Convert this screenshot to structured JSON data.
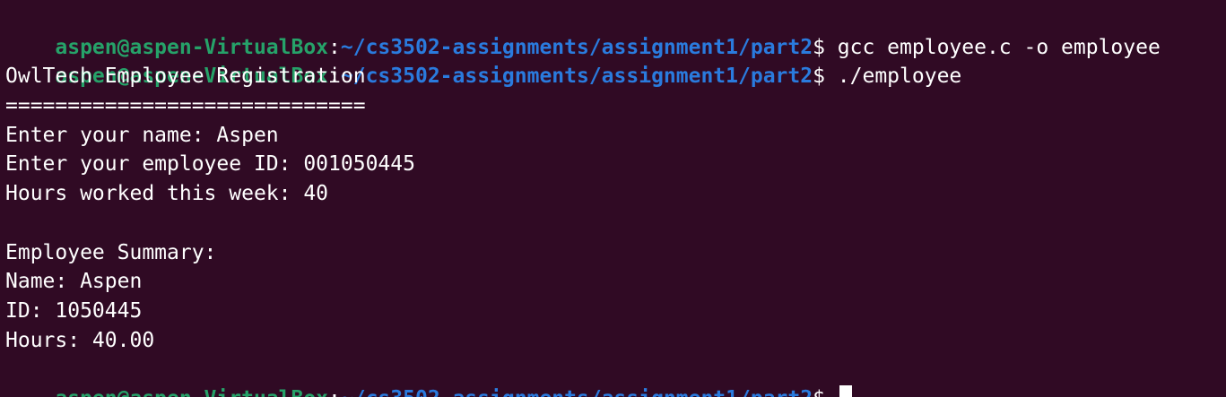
{
  "prompt": {
    "user_host": "aspen@aspen-VirtualBox",
    "colon": ":",
    "path": "~/cs3502-assignments/assignment1/part2",
    "symbol": "$ "
  },
  "lines": [
    {
      "type": "prompt",
      "command": "gcc employee.c -o employee"
    },
    {
      "type": "prompt",
      "command": "./employee"
    },
    {
      "type": "output",
      "text": "OwlTech Employee Registration"
    },
    {
      "type": "output",
      "text": "============================="
    },
    {
      "type": "output",
      "text": "Enter your name: Aspen"
    },
    {
      "type": "output",
      "text": "Enter your employee ID: 001050445"
    },
    {
      "type": "output",
      "text": "Hours worked this week: 40"
    },
    {
      "type": "output",
      "text": ""
    },
    {
      "type": "output",
      "text": "Employee Summary:"
    },
    {
      "type": "output",
      "text": "Name: Aspen"
    },
    {
      "type": "output",
      "text": "ID: 1050445"
    },
    {
      "type": "output",
      "text": "Hours: 40.00"
    },
    {
      "type": "prompt",
      "command": ""
    }
  ],
  "colors": {
    "background": "#300a24",
    "user_host": "#26a269",
    "path": "#2a7bde",
    "text": "#ffffff"
  }
}
